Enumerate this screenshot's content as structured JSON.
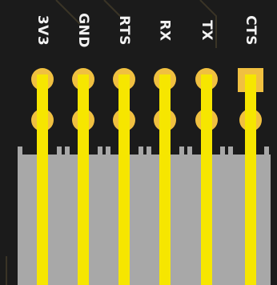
{
  "pins": [
    {
      "label": "3V3",
      "pad_shape": "round"
    },
    {
      "label": "GND",
      "pad_shape": "round"
    },
    {
      "label": "RTS",
      "pad_shape": "round"
    },
    {
      "label": "RX",
      "pad_shape": "round"
    },
    {
      "label": "TX",
      "pad_shape": "round"
    },
    {
      "label": "CTS",
      "pad_shape": "square"
    }
  ],
  "colors": {
    "board": "#1b1b1b",
    "silkscreen": "#f2f2f2",
    "pad": "#f0c040",
    "pad_hole": "#808080",
    "pin": "#f6e600",
    "connector": "#a8a8a8",
    "trace": "#3a3426"
  }
}
